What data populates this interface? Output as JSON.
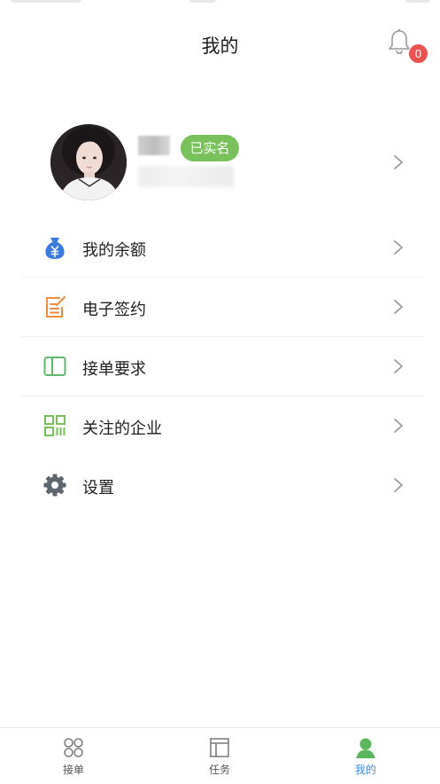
{
  "header": {
    "title": "我的",
    "notification_count": "0"
  },
  "profile": {
    "verified_badge": "已实名"
  },
  "menu": {
    "items": [
      {
        "label": "我的余额",
        "icon": "money-bag-icon",
        "color": "#3a7be0"
      },
      {
        "label": "电子签约",
        "icon": "sign-contract-icon",
        "color": "#f08a3c"
      },
      {
        "label": "接单要求",
        "icon": "book-icon",
        "color": "#5db86a"
      },
      {
        "label": "关注的企业",
        "icon": "qr-grid-icon",
        "color": "#79c25b"
      },
      {
        "label": "设置",
        "icon": "gear-icon",
        "color": "#5e6670"
      }
    ]
  },
  "tabbar": {
    "tabs": [
      {
        "label": "接单",
        "icon": "grid-circles-icon",
        "active": false
      },
      {
        "label": "任务",
        "icon": "task-board-icon",
        "active": false
      },
      {
        "label": "我的",
        "icon": "person-icon",
        "active": true
      }
    ],
    "active_color": "#3d8ce0",
    "active_icon_color": "#5cb85c"
  },
  "colors": {
    "badge": "#e8534f",
    "verified": "#79c25b"
  }
}
